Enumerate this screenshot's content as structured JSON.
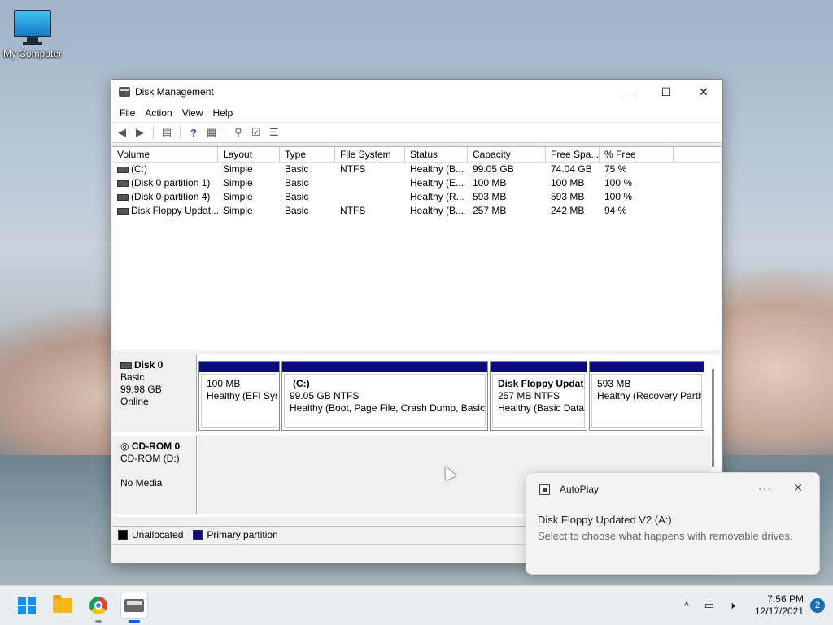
{
  "desktop": {
    "icon_label": "My Computer"
  },
  "window": {
    "title": "Disk Management",
    "controls": {
      "minimize": "—",
      "maximize": "☐",
      "close": "✕"
    },
    "menu": [
      "File",
      "Action",
      "View",
      "Help"
    ],
    "columns": [
      "Volume",
      "Layout",
      "Type",
      "File System",
      "Status",
      "Capacity",
      "Free Spa...",
      "% Free"
    ],
    "volumes": [
      {
        "volume": "(C:)",
        "layout": "Simple",
        "type": "Basic",
        "fs": "NTFS",
        "status": "Healthy (B...",
        "capacity": "99.05 GB",
        "free": "74.04 GB",
        "pct": "75 %"
      },
      {
        "volume": "(Disk 0 partition 1)",
        "layout": "Simple",
        "type": "Basic",
        "fs": "",
        "status": "Healthy (E...",
        "capacity": "100 MB",
        "free": "100 MB",
        "pct": "100 %"
      },
      {
        "volume": "(Disk 0 partition 4)",
        "layout": "Simple",
        "type": "Basic",
        "fs": "",
        "status": "Healthy (R...",
        "capacity": "593 MB",
        "free": "593 MB",
        "pct": "100 %"
      },
      {
        "volume": "Disk Floppy Updat...",
        "layout": "Simple",
        "type": "Basic",
        "fs": "NTFS",
        "status": "Healthy (B...",
        "capacity": "257 MB",
        "free": "242 MB",
        "pct": "94 %"
      }
    ],
    "disk0": {
      "name": "Disk 0",
      "type": "Basic",
      "size": "99.98 GB",
      "state": "Online",
      "partitions": [
        {
          "name": "",
          "size": "100 MB",
          "status": "Healthy (EFI Syst"
        },
        {
          "name": "(C:)",
          "size": "99.05 GB NTFS",
          "status": "Healthy (Boot, Page File, Crash Dump, Basic D"
        },
        {
          "name": "Disk Floppy Update",
          "size": "257 MB NTFS",
          "status": "Healthy (Basic Data I"
        },
        {
          "name": "",
          "size": "593 MB",
          "status": "Healthy (Recovery Partit"
        }
      ]
    },
    "cdrom": {
      "name": "CD-ROM 0",
      "drive": "CD-ROM (D:)",
      "media": "No Media"
    },
    "legend": {
      "unallocated": "Unallocated",
      "primary": "Primary partition"
    },
    "colors": {
      "partition_bar": "#0b0b7d",
      "unallocated": "#000000"
    }
  },
  "toast": {
    "app": "AutoPlay",
    "more": "···",
    "close": "✕",
    "title": "Disk Floppy Updated V2 (A:)",
    "body": "Select to choose what happens with removable drives."
  },
  "taskbar": {
    "time": "7:56 PM",
    "date": "12/17/2021",
    "notifications": "2",
    "tray_chevron": "^"
  }
}
